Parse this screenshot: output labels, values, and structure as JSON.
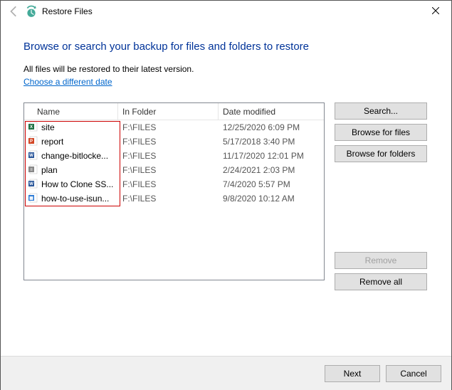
{
  "window": {
    "title": "Restore Files"
  },
  "heading": "Browse or search your backup for files and folders to restore",
  "description": "All files will be restored to their latest version.",
  "link": "Choose a different date",
  "columns": {
    "name": "Name",
    "folder": "In Folder",
    "date": "Date modified"
  },
  "rows": [
    {
      "icon": "excel",
      "name": "site",
      "folder": "F:\\FILES",
      "date": "12/25/2020 6:09 PM"
    },
    {
      "icon": "ppt",
      "name": "report",
      "folder": "F:\\FILES",
      "date": "5/17/2018 3:40 PM"
    },
    {
      "icon": "word",
      "name": "change-bitlocke...",
      "folder": "F:\\FILES",
      "date": "11/17/2020 12:01 PM"
    },
    {
      "icon": "text",
      "name": "plan",
      "folder": "F:\\FILES",
      "date": "2/24/2021 2:03 PM"
    },
    {
      "icon": "word",
      "name": "How to Clone SS...",
      "folder": "F:\\FILES",
      "date": "7/4/2020 5:57 PM"
    },
    {
      "icon": "image",
      "name": "how-to-use-isun...",
      "folder": "F:\\FILES",
      "date": "9/8/2020 10:12 AM"
    }
  ],
  "buttons": {
    "search": "Search...",
    "browseFiles": "Browse for files",
    "browseFolders": "Browse for folders",
    "remove": "Remove",
    "removeAll": "Remove all",
    "next": "Next",
    "cancel": "Cancel"
  }
}
